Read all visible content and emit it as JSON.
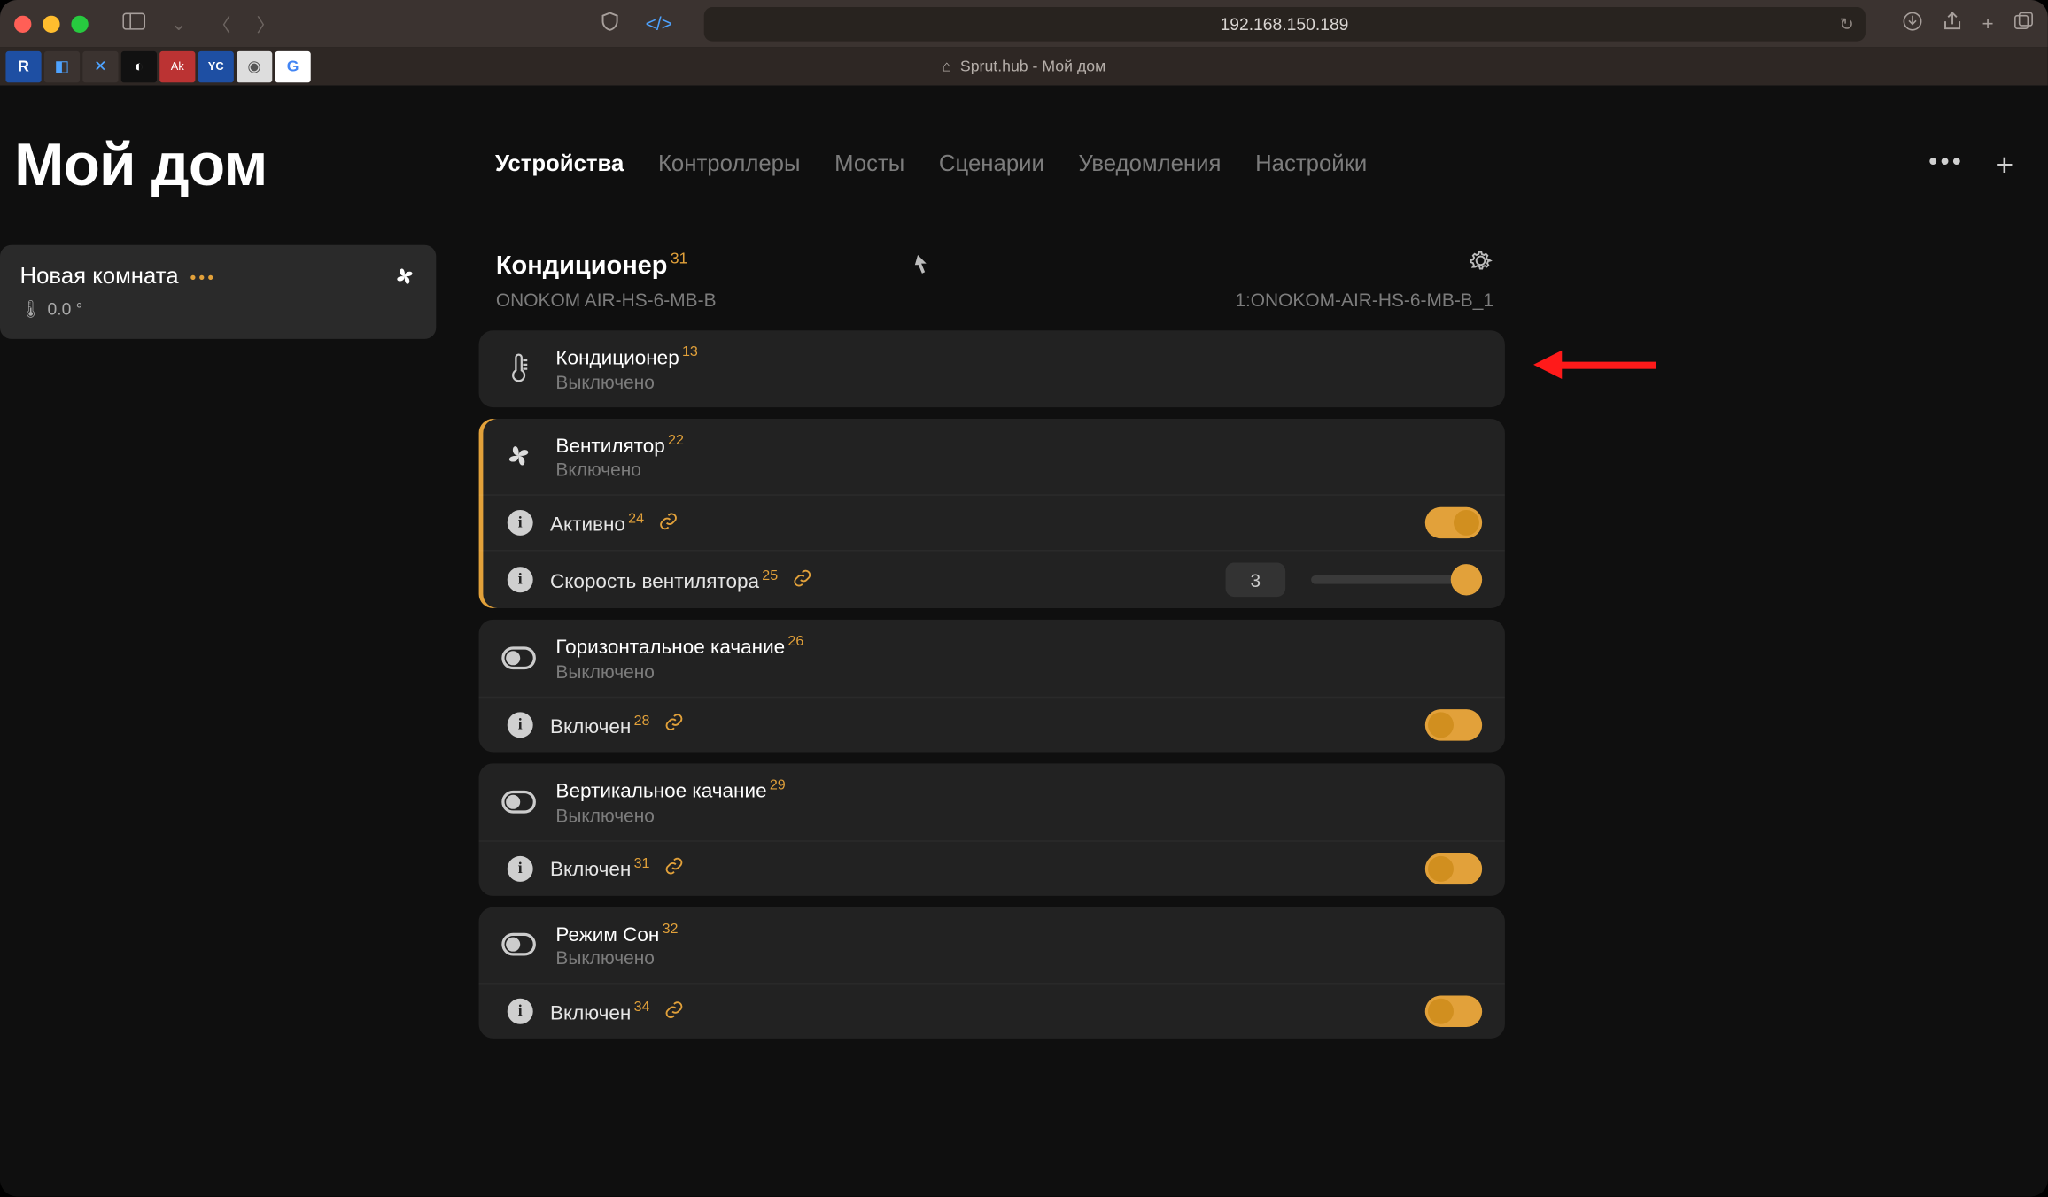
{
  "browser": {
    "url": "192.168.150.189",
    "tab_title": "Sprut.hub - Мой дом"
  },
  "app": {
    "title": "Мой дом",
    "nav": [
      {
        "label": "Устройства",
        "active": true
      },
      {
        "label": "Контроллеры",
        "active": false
      },
      {
        "label": "Мосты",
        "active": false
      },
      {
        "label": "Сценарии",
        "active": false
      },
      {
        "label": "Уведомления",
        "active": false
      },
      {
        "label": "Настройки",
        "active": false
      }
    ]
  },
  "room": {
    "name": "Новая комната",
    "temp": "0.0 °"
  },
  "device": {
    "name": "Кондиционер",
    "name_sup": "31",
    "model": "ONOKOM AIR-HS-6-MB-B",
    "id": "1:ONOKOM-AIR-HS-6-MB-B_1"
  },
  "tiles": [
    {
      "key": "ac",
      "title": "Кондиционер",
      "sup": "13",
      "sub": "Выключено",
      "active": false,
      "icon": "thermo",
      "rows": []
    },
    {
      "key": "fan",
      "title": "Вентилятор",
      "sup": "22",
      "sub": "Включено",
      "active": true,
      "icon": "fan",
      "rows": [
        {
          "label": "Активно",
          "sup": "24",
          "ctrl": "switch-right"
        },
        {
          "label": "Скорость вентилятора",
          "sup": "25",
          "ctrl": "slider",
          "value": "3"
        }
      ]
    },
    {
      "key": "hswing",
      "title": "Горизонтальное качание",
      "sup": "26",
      "sub": "Выключено",
      "active": false,
      "icon": "toggle",
      "rows": [
        {
          "label": "Включен",
          "sup": "28",
          "ctrl": "switch-left"
        }
      ]
    },
    {
      "key": "vswing",
      "title": "Вертикальное качание",
      "sup": "29",
      "sub": "Выключено",
      "active": false,
      "icon": "toggle",
      "rows": [
        {
          "label": "Включен",
          "sup": "31",
          "ctrl": "switch-left"
        }
      ]
    },
    {
      "key": "sleep",
      "title": "Режим Сон",
      "sup": "32",
      "sub": "Выключено",
      "active": false,
      "icon": "toggle",
      "rows": [
        {
          "label": "Включен",
          "sup": "34",
          "ctrl": "switch-left"
        }
      ]
    }
  ]
}
